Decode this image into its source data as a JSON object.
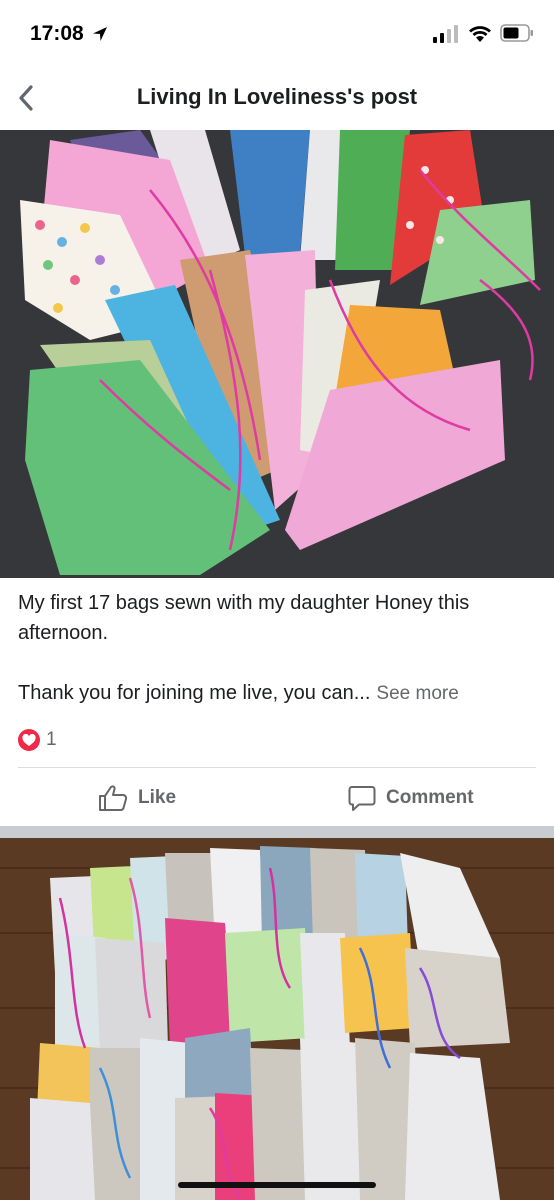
{
  "status_bar": {
    "time": "17:08",
    "icons": [
      "location-arrow-icon",
      "cellular-signal-icon",
      "wifi-icon",
      "battery-icon"
    ]
  },
  "header": {
    "title": "Living In Loveliness's post",
    "back_icon": "chevron-left-icon"
  },
  "post": {
    "photo_1": "drawstring-bags-fan-photo",
    "text_line_1": "My first 17 bags sewn with my daughter Honey this afternoon.",
    "text_line_2": "Thank you for joining me live, you can...",
    "see_more": "See more",
    "reaction_icon": "love-reaction-icon",
    "reaction_count": "1",
    "actions": {
      "like": "Like",
      "comment": "Comment"
    },
    "photo_2": "drawstring-bags-on-floor-photo"
  },
  "colors": {
    "text_primary": "#1c1e21",
    "text_secondary": "#65676b",
    "love_red": "#f0284a",
    "separator": "#c9ccd1"
  }
}
